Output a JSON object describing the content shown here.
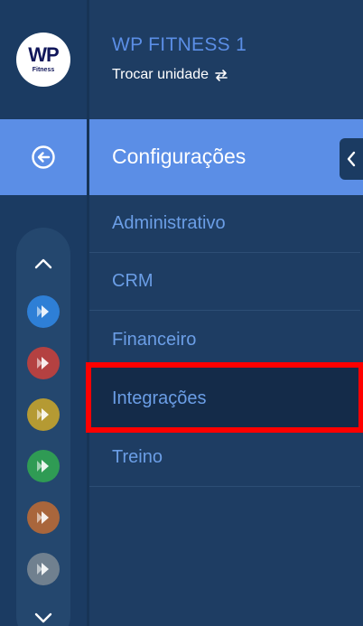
{
  "sidebar": {
    "logo": {
      "line1": "WP",
      "line2": "Fitness"
    },
    "back_icon": "circle-arrow-left-icon",
    "scroll_up_icon": "chevron-up-icon",
    "scroll_down_icon": "chevron-down-icon",
    "modules": [
      {
        "name": "module-blue",
        "color": "#2e7fd6"
      },
      {
        "name": "module-red",
        "color": "#b44141"
      },
      {
        "name": "module-yellow",
        "color": "#b59a33"
      },
      {
        "name": "module-green",
        "color": "#2f9b54"
      },
      {
        "name": "module-orange",
        "color": "#a9663c"
      },
      {
        "name": "module-gray",
        "color": "#70808f"
      }
    ]
  },
  "header": {
    "company": "WP FITNESS 1",
    "switch_label": "Trocar unidade",
    "switch_icon": "swap-icon"
  },
  "section": {
    "title": "Configurações",
    "collapse_icon": "chevron-left-icon"
  },
  "menu": {
    "items": [
      "Administrativo",
      "CRM",
      "Financeiro",
      "Integrações",
      "Treino"
    ],
    "active": "Integrações"
  },
  "colors": {
    "accent": "#5b8ee6",
    "menu_text": "#6b9ee6",
    "highlight_border": "#ff0000"
  }
}
